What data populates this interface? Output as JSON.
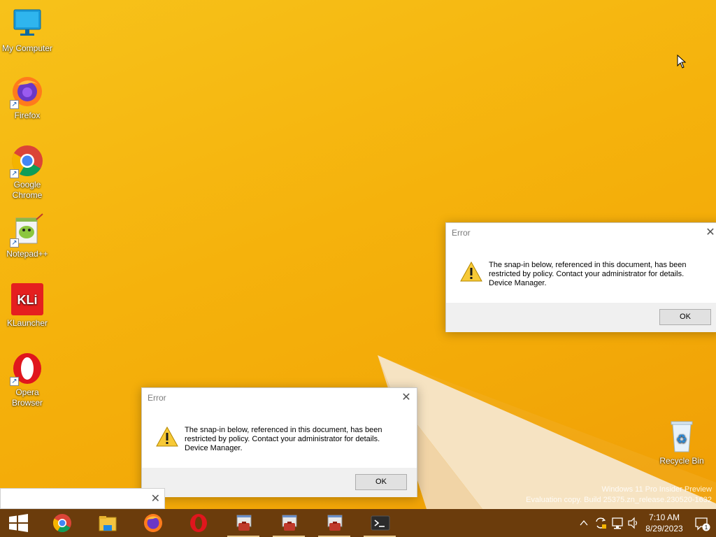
{
  "desktop": {
    "icons": [
      {
        "label": "My Computer",
        "icon": "monitor-icon"
      },
      {
        "label": "Firefox",
        "icon": "firefox-icon"
      },
      {
        "label": "Google Chrome",
        "icon": "chrome-icon"
      },
      {
        "label": "Notepad++",
        "icon": "notepadpp-icon"
      },
      {
        "label": "KLauncher",
        "icon": "klauncher-icon"
      },
      {
        "label": "Opera Browser",
        "icon": "opera-icon"
      },
      {
        "label": "Recycle Bin",
        "icon": "recycle-bin-icon"
      }
    ],
    "klauncher_logo_text": "KLi",
    "watermark_line1": "Windows 11 Pro Insider Preview",
    "watermark_line2": "Evaluation copy. Build 25375.zn_release.230520-1632"
  },
  "dialogs": [
    {
      "title": "Error",
      "message_line1": "The snap-in below, referenced in this document, has been",
      "message_line2": "restricted by policy. Contact your administrator for details.",
      "message_line3": "Device Manager.",
      "ok_label": "OK"
    },
    {
      "title": "Error",
      "message_line1": "The snap-in below, referenced in this document, has been",
      "message_line2": "restricted by policy. Contact your administrator for details.",
      "message_line3": "Device Manager.",
      "ok_label": "OK"
    }
  ],
  "taskbar": {
    "pinned": [
      "start-icon",
      "chrome-icon",
      "file-explorer-icon",
      "firefox-icon",
      "opera-icon",
      "mmc-icon",
      "mmc-icon",
      "mmc-icon",
      "terminal-icon"
    ],
    "clock_time": "7:10 AM",
    "clock_date": "8/29/2023",
    "notification_count": "1"
  },
  "colors": {
    "wallpaper": "#f5b40a",
    "taskbar": "#6b3c0c",
    "dialog_footer": "#f0f0f0"
  }
}
